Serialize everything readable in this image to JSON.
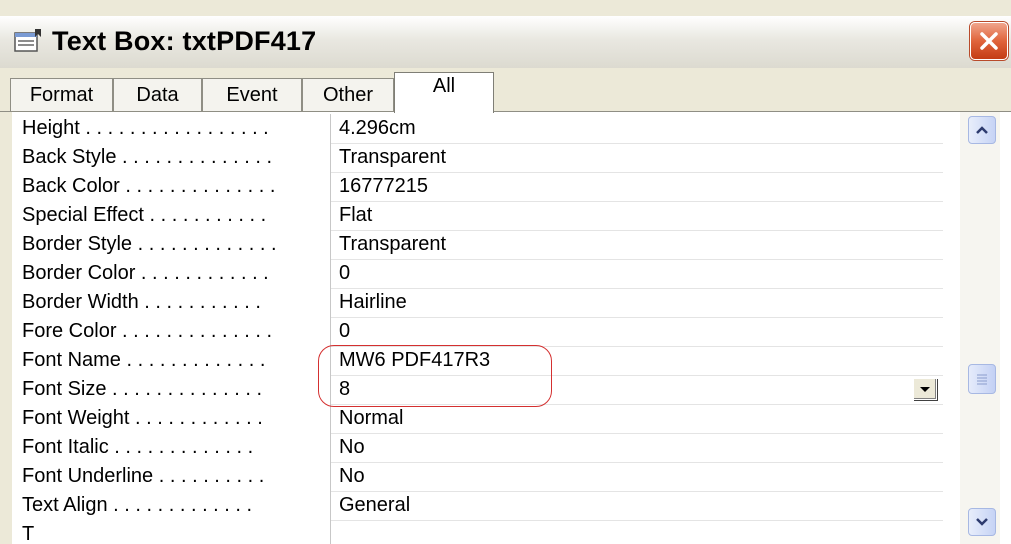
{
  "window": {
    "title": "Text Box: txtPDF417"
  },
  "tabs": [
    {
      "label": "Format",
      "active": false
    },
    {
      "label": "Data",
      "active": false
    },
    {
      "label": "Event",
      "active": false
    },
    {
      "label": "Other",
      "active": false
    },
    {
      "label": "All",
      "active": true
    }
  ],
  "properties": [
    {
      "name": "Height . . . . . . . . . . . . . . . . .",
      "value": "4.296cm"
    },
    {
      "name": "Back Style . . . . . . . . . . . . . .",
      "value": "Transparent"
    },
    {
      "name": "Back Color . . . . . . . . . . . . . .",
      "value": "16777215"
    },
    {
      "name": "Special Effect . . . . . . . . . . .",
      "value": "Flat"
    },
    {
      "name": "Border Style . . . . . . . . . . . . .",
      "value": "Transparent"
    },
    {
      "name": "Border Color . . . . . . . . . . . .",
      "value": "0"
    },
    {
      "name": "Border Width . . . . . . . . . . .",
      "value": "Hairline"
    },
    {
      "name": "Fore Color . . . . . . . . . . . . . .",
      "value": "0"
    },
    {
      "name": "Font Name . . . . . . . . . . . . .",
      "value": "MW6 PDF417R3"
    },
    {
      "name": "Font Size . . . . . . . . . . . . . .",
      "value": "8"
    },
    {
      "name": "Font Weight . . . . . . . . . . . .",
      "value": "Normal"
    },
    {
      "name": "Font Italic . . . . . . . . . . . . .",
      "value": "No"
    },
    {
      "name": "Font Underline . . . . . . . . . .",
      "value": "No"
    },
    {
      "name": "Text Align . . . . . . . . . . . . .",
      "value": "General"
    },
    {
      "name": "T",
      "value": ""
    }
  ],
  "icons": {
    "title": "property-sheet-icon",
    "close": "close-icon",
    "dropdown": "dropdown-arrow-icon",
    "scroll_up": "chevron-up-icon",
    "scroll_down": "chevron-down-icon",
    "thumb": "grip-icon"
  },
  "colors": {
    "highlight": "#d43030",
    "close_button": "#e0643c"
  }
}
